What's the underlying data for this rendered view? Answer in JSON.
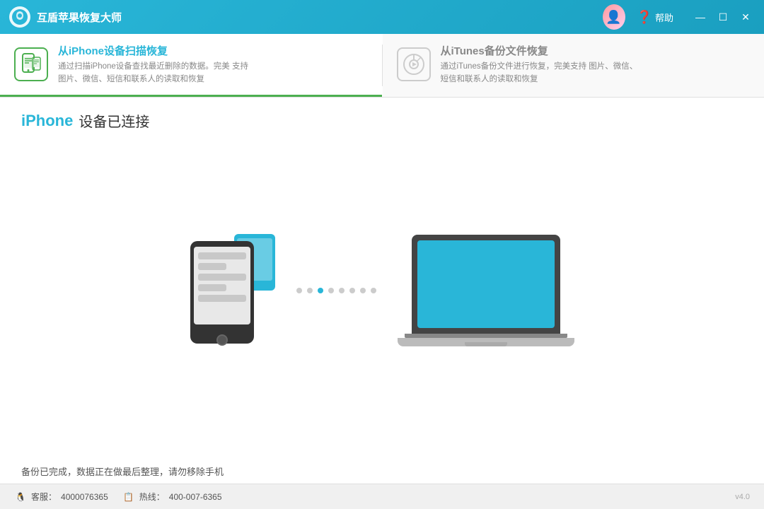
{
  "titleBar": {
    "appTitle": "互盾苹果恢复大师",
    "helpLabel": "帮助"
  },
  "tabs": [
    {
      "id": "scan",
      "title": "从iPhone设备扫描恢复",
      "description": "通过扫描iPhone设备查找最近删除的数据。完美\n支持图片、微信、短信和联系人的读取和恢复",
      "active": true
    },
    {
      "id": "itunes",
      "title": "从iTunes备份文件恢复",
      "description": "通过iTunes备份文件进行恢复，完美支持\n图片、微信、短信和联系人的读取和恢复",
      "active": false
    }
  ],
  "main": {
    "deviceLabel": "iPhone",
    "statusLabel": "设备已连接",
    "dots": [
      {
        "active": false
      },
      {
        "active": false
      },
      {
        "active": true
      },
      {
        "active": false
      },
      {
        "active": false
      },
      {
        "active": false
      },
      {
        "active": false
      },
      {
        "active": false
      }
    ],
    "footerStatus": "备份已完成，数据正在做最后整理，请勿移除手机"
  },
  "bottomBar": {
    "customerServiceIcon": "🐧",
    "customerServiceLabel": "客服：",
    "customerServiceNumber": "4000076365",
    "hotlineIcon": "📱",
    "hotlineLabel": "热线：",
    "hotlineNumber": "400-007-6365",
    "version": "v4.0"
  }
}
